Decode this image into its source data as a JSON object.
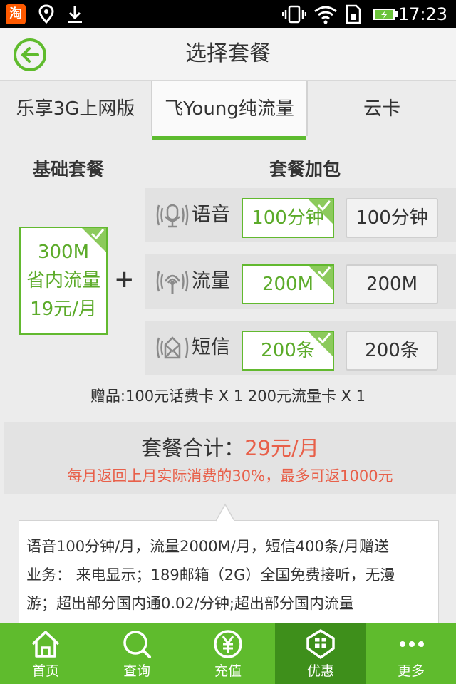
{
  "status_bar": {
    "taobao_glyph": "淘",
    "time": "17:23"
  },
  "header": {
    "title": "选择套餐",
    "back_icon": "back-arrow-circle-icon"
  },
  "tabs": [
    {
      "label": "乐享3G上网版",
      "selected": false
    },
    {
      "label": "飞Young纯流量",
      "selected": true
    },
    {
      "label": "云卡",
      "selected": false
    }
  ],
  "sections": {
    "base_label": "基础套餐",
    "addon_label": "套餐加包"
  },
  "base_package": {
    "line1": "300M",
    "line2": "省内流量",
    "line3": "19元/月",
    "selected": true
  },
  "plus_sign": "+",
  "addons": [
    {
      "icon": "microphone-icon",
      "label": "语音",
      "selected_option": "100分钟",
      "other_option": "100分钟"
    },
    {
      "icon": "wifi-signal-icon",
      "label": "流量",
      "selected_option": "200M",
      "other_option": "200M"
    },
    {
      "icon": "envelope-icon",
      "label": "短信",
      "selected_option": "200条",
      "other_option": "200条"
    }
  ],
  "gift": "赠品:100元话费卡 X 1  200元流量卡 X 1",
  "total": {
    "label": "套餐合计：",
    "price": "29元/月",
    "rebate": "每月返回上月实际消费的30%，最多可返1000元"
  },
  "description": {
    "line1": "语音100分钟/月，流量2000M/月，短信400条/月赠送",
    "line2": "业务： 来电显示；189邮箱（2G）全国免费接听，无漫",
    "line3": "游；超出部分国内通0.02/分钟;超出部分国内流量"
  },
  "bottom_nav": [
    {
      "label": "首页",
      "icon": "home-icon",
      "active": false
    },
    {
      "label": "查询",
      "icon": "search-icon",
      "active": false
    },
    {
      "label": "充值",
      "icon": "yuan-coin-icon",
      "active": false
    },
    {
      "label": "优惠",
      "icon": "discount-icon",
      "active": true
    },
    {
      "label": "更多",
      "icon": "more-dots-icon",
      "active": false
    }
  ],
  "colors": {
    "accent_green": "#5fbb2d",
    "nav_active": "#3e8f1b",
    "price_red": "#e8604a"
  }
}
